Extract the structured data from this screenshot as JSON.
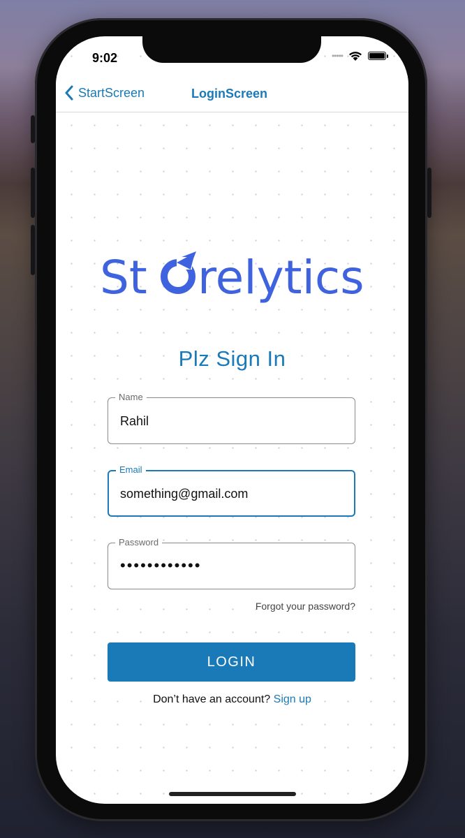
{
  "status_bar": {
    "time": "9:02"
  },
  "nav": {
    "back_label": "StartScreen",
    "title": "LoginScreen"
  },
  "logo": {
    "text": "Storelytics",
    "color": "#3f63df"
  },
  "heading": "Plz Sign In",
  "fields": {
    "name": {
      "label": "Name",
      "value": "Rahil"
    },
    "email": {
      "label": "Email",
      "value": "something@gmail.com"
    },
    "password": {
      "label": "Password",
      "value": "••••••••••••"
    }
  },
  "forgot_password": "Forgot your password?",
  "login_button": "LOGIN",
  "signup": {
    "prompt": "Don’t have an account?",
    "link": "Sign up"
  },
  "colors": {
    "accent": "#1a7ab8",
    "logo": "#3f63df"
  }
}
